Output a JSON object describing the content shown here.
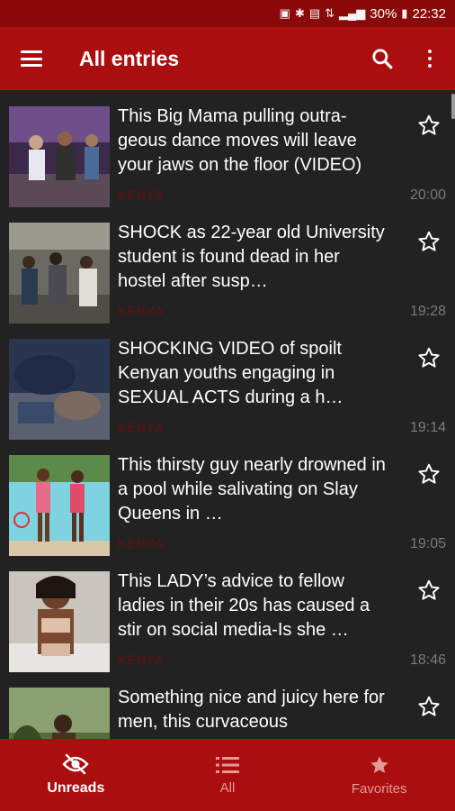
{
  "status_bar": {
    "battery": "30%",
    "time": "22:32",
    "icons": [
      "sim-icon",
      "bluetooth-icon",
      "nfc-icon",
      "wifi-4g-icon",
      "signal-icon",
      "battery-icon"
    ]
  },
  "app_bar": {
    "title": "All entries",
    "icons": [
      "menu-icon",
      "search-icon",
      "more-vert-icon"
    ]
  },
  "entries": [
    {
      "title": "This Big Mama pulling outra-geous dance moves will leave your jaws on the floor (VIDEO)",
      "source": "KENYA",
      "time": "20:00",
      "thumb": "dance-party-photo"
    },
    {
      "title": "SHOCK as 22-year old University student is found dead in her hostel after susp…",
      "source": "KENYA",
      "time": "19:28",
      "thumb": "crowd-outside-hostel-photo"
    },
    {
      "title": "SHOCKING VIDEO of spoilt Kenyan youths engaging in SEXUAL  ACTS  during a h…",
      "source": "KENYA",
      "time": "19:14",
      "thumb": "party-video-photo"
    },
    {
      "title": "This thirsty guy nearly drowned in a pool while salivating on Slay Queens in …",
      "source": "KENYA",
      "time": "19:05",
      "thumb": "pool-women-photo"
    },
    {
      "title": "This LADY’s advice to fellow ladies in their 20s has caused a stir on social media-Is she …",
      "source": "KENYA",
      "time": "18:46",
      "thumb": "lady-portrait-photo"
    },
    {
      "title": "Something nice and juicy here for men, this curvaceous",
      "source": "",
      "time": "",
      "thumb": "outdoor-woman-photo"
    }
  ],
  "bottom_nav": [
    {
      "label": "Unreads",
      "icon": "eye-off-icon",
      "active": true
    },
    {
      "label": "All",
      "icon": "list-icon",
      "active": false
    },
    {
      "label": "Favorites",
      "icon": "star-icon",
      "active": false
    }
  ],
  "colors": {
    "status_bar": "#8a0a0a",
    "app_bar": "#ab0e0e",
    "background": "#222222",
    "source_text": "#6b0d0d",
    "time_text": "#7a7a7a"
  }
}
